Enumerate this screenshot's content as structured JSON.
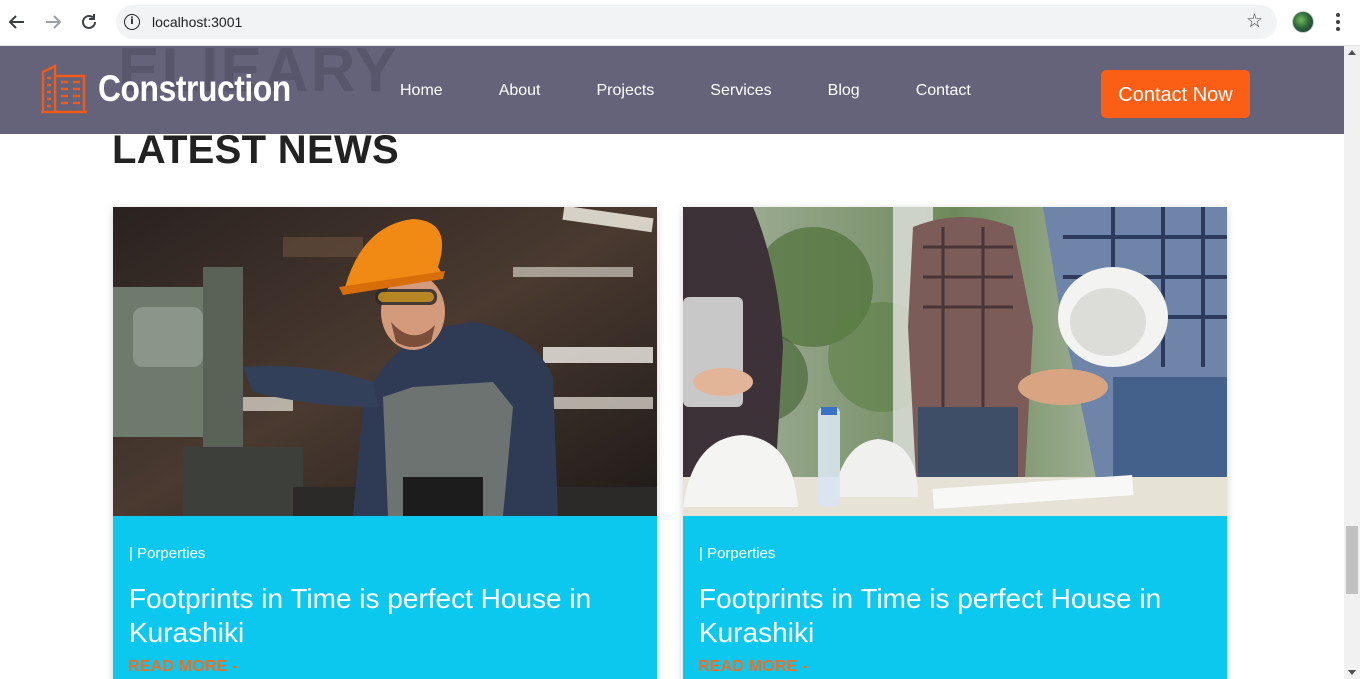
{
  "browser": {
    "url": "localhost:3001",
    "icons": [
      "back-arrow-icon",
      "forward-arrow-icon",
      "reload-icon",
      "info-icon",
      "star-icon",
      "profile-icon",
      "kebab-menu-icon"
    ]
  },
  "header": {
    "ghost_text": "ELIEARY",
    "logo_text": "Construction",
    "nav": [
      "Home",
      "About",
      "Projects",
      "Services",
      "Blog",
      "Contact"
    ],
    "cta_label": "Contact Now",
    "colors": {
      "header_bg": "#585770",
      "accent": "#fb5f16"
    }
  },
  "news": {
    "title": "LATEST NEWS",
    "cards": [
      {
        "image": "construction worker in orange hard hat operating machinery",
        "tag": "| Porperties",
        "title": "Footprints in Time is perfect House in Kurashiki",
        "link": "READ MORE -"
      },
      {
        "image": "engineers shaking hands over white hard hats and blueprints",
        "tag": "| Porperties",
        "title": "Footprints in Time is perfect House in Kurashiki",
        "link": "READ MORE -"
      }
    ],
    "colors": {
      "card_bg": "#0cc8ee",
      "link": "#f36c20"
    }
  }
}
